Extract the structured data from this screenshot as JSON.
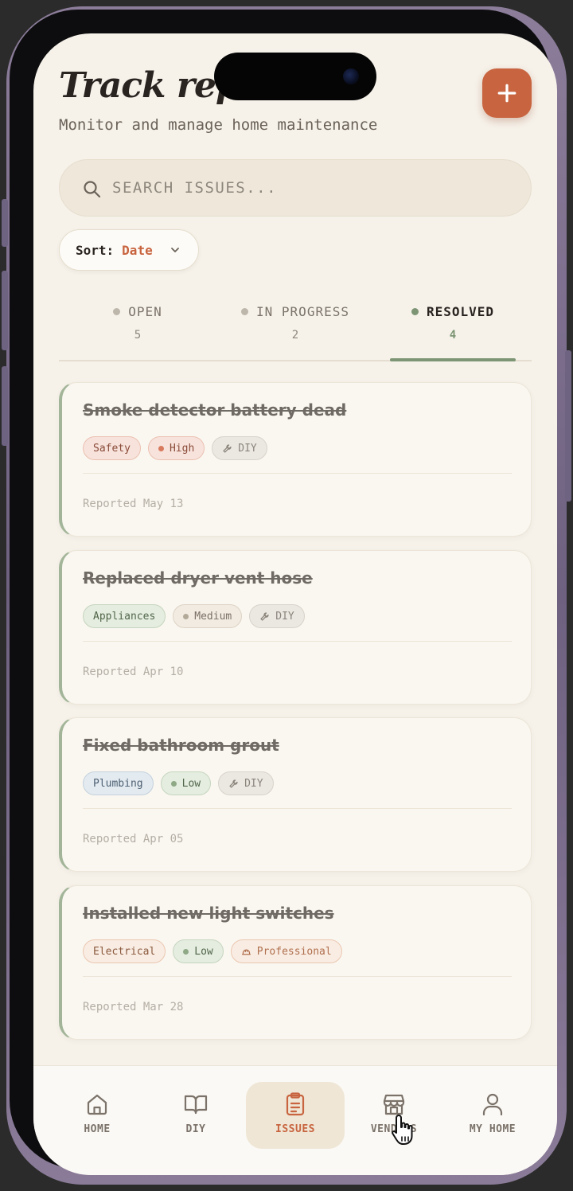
{
  "header": {
    "title": "Track repairs",
    "subtitle": "Monitor and manage home maintenance",
    "add_icon": "plus-icon"
  },
  "search": {
    "placeholder": "SEARCH ISSUES...",
    "value": "",
    "icon": "search-icon"
  },
  "sort": {
    "label": "Sort:",
    "value": "Date"
  },
  "tabs": [
    {
      "label": "OPEN",
      "count": "5"
    },
    {
      "label": "IN PROGRESS",
      "count": "2"
    },
    {
      "label": "RESOLVED",
      "count": "4"
    }
  ],
  "active_tab": "RESOLVED",
  "issues": [
    {
      "title": "Smoke detector battery dead",
      "category": "Safety",
      "priority": "High",
      "handler": "DIY",
      "reported": "Reported May 13"
    },
    {
      "title": "Replaced dryer vent hose",
      "category": "Appliances",
      "priority": "Medium",
      "handler": "DIY",
      "reported": "Reported Apr 10"
    },
    {
      "title": "Fixed bathroom grout",
      "category": "Plumbing",
      "priority": "Low",
      "handler": "DIY",
      "reported": "Reported Apr 05"
    },
    {
      "title": "Installed new light switches",
      "category": "Electrical",
      "priority": "Low",
      "handler": "Professional",
      "reported": "Reported Mar 28"
    }
  ],
  "nav": [
    {
      "label": "HOME",
      "icon": "home-icon"
    },
    {
      "label": "DIY",
      "icon": "book-icon"
    },
    {
      "label": "ISSUES",
      "icon": "clipboard-icon"
    },
    {
      "label": "VENDORS",
      "icon": "store-icon"
    },
    {
      "label": "MY HOME",
      "icon": "user-icon"
    }
  ],
  "active_nav": "ISSUES",
  "colors": {
    "accent": "#c8643f",
    "resolved_green": "#7d9574",
    "background": "#f6f2ea"
  }
}
